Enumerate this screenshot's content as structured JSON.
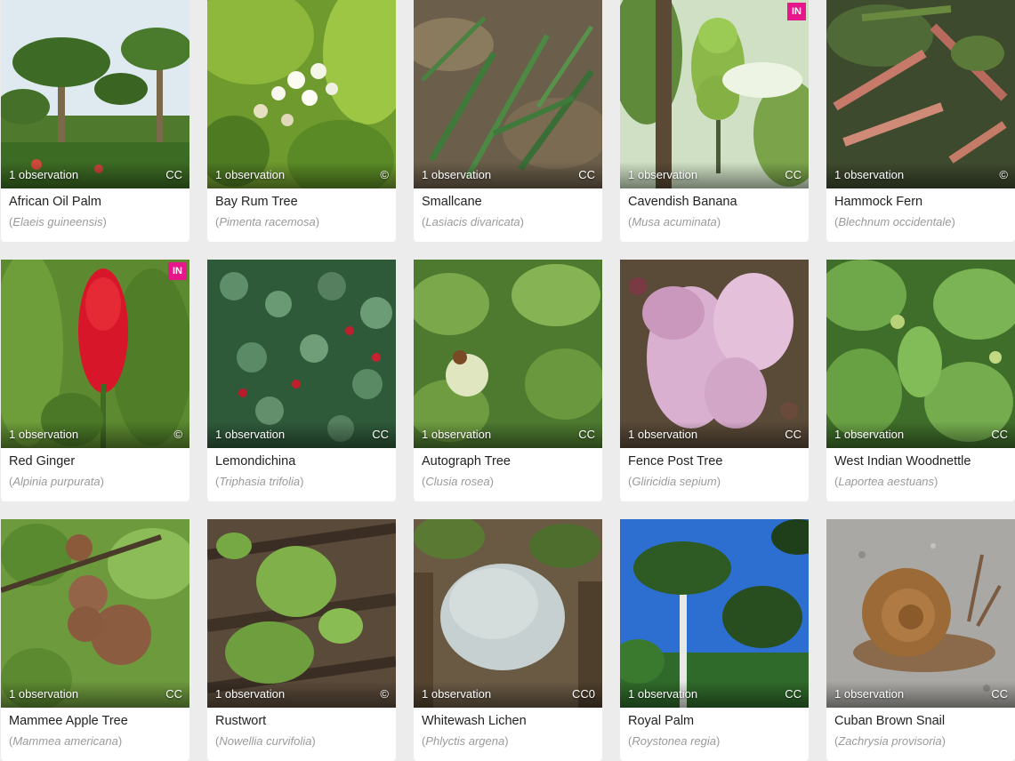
{
  "species": [
    {
      "common": "African Oil Palm",
      "scientific": "Elaeis guineensis",
      "observations": "1 observation",
      "license": "CC",
      "badge": ""
    },
    {
      "common": "Bay Rum Tree",
      "scientific": "Pimenta racemosa",
      "observations": "1 observation",
      "license": "©",
      "badge": ""
    },
    {
      "common": "Smallcane",
      "scientific": "Lasiacis divaricata",
      "observations": "1 observation",
      "license": "CC",
      "badge": ""
    },
    {
      "common": "Cavendish Banana",
      "scientific": "Musa acuminata",
      "observations": "1 observation",
      "license": "CC",
      "badge": "IN"
    },
    {
      "common": "Hammock Fern",
      "scientific": "Blechnum occidentale",
      "observations": "1 observation",
      "license": "©",
      "badge": ""
    },
    {
      "common": "Red Ginger",
      "scientific": "Alpinia purpurata",
      "observations": "1 observation",
      "license": "©",
      "badge": "IN"
    },
    {
      "common": "Lemondichina",
      "scientific": "Triphasia trifolia",
      "observations": "1 observation",
      "license": "CC",
      "badge": ""
    },
    {
      "common": "Autograph Tree",
      "scientific": "Clusia rosea",
      "observations": "1 observation",
      "license": "CC",
      "badge": ""
    },
    {
      "common": "Fence Post Tree",
      "scientific": "Gliricidia sepium",
      "observations": "1 observation",
      "license": "CC",
      "badge": ""
    },
    {
      "common": "West Indian Woodnettle",
      "scientific": "Laportea aestuans",
      "observations": "1 observation",
      "license": "CC",
      "badge": ""
    },
    {
      "common": "Mammee Apple Tree",
      "scientific": "Mammea americana",
      "observations": "1 observation",
      "license": "CC",
      "badge": ""
    },
    {
      "common": "Rustwort",
      "scientific": "Nowellia curvifolia",
      "observations": "1 observation",
      "license": "©",
      "badge": ""
    },
    {
      "common": "Whitewash Lichen",
      "scientific": "Phlyctis argena",
      "observations": "1 observation",
      "license": "CC0",
      "badge": ""
    },
    {
      "common": "Royal Palm",
      "scientific": "Roystonea regia",
      "observations": "1 observation",
      "license": "CC",
      "badge": ""
    },
    {
      "common": "Cuban Brown Snail",
      "scientific": "Zachrysia provisoria",
      "observations": "1 observation",
      "license": "CC",
      "badge": ""
    }
  ],
  "colors": {
    "badge": "#e6168b",
    "common_name": "#222222",
    "scientific_name": "#9a9a9a",
    "background": "#ececec"
  }
}
